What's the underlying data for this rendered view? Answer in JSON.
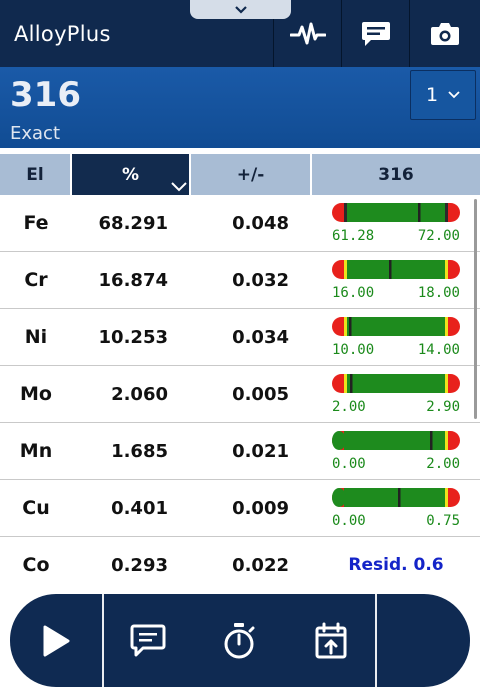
{
  "header": {
    "title": "AlloyPlus",
    "buttons": [
      {
        "icon": "waveform-icon"
      },
      {
        "icon": "comment-icon"
      },
      {
        "icon": "camera-icon"
      }
    ]
  },
  "banner": {
    "alloy_name": "316",
    "match_label": "Exact",
    "match_select_value": "1"
  },
  "columns": {
    "element": "El",
    "percent": "%",
    "error": "+/-",
    "grade": "316"
  },
  "rows": [
    {
      "el": "Fe",
      "pct": "68.291",
      "err": "0.048",
      "min": "61.28",
      "max": "72.00",
      "marker": 0.72,
      "low_zone": "red",
      "high_zone": "red"
    },
    {
      "el": "Cr",
      "pct": "16.874",
      "err": "0.032",
      "min": "16.00",
      "max": "18.00",
      "marker": 0.44,
      "low_zone": "yellow",
      "high_zone": "yellow"
    },
    {
      "el": "Ni",
      "pct": "10.253",
      "err": "0.034",
      "min": "10.00",
      "max": "14.00",
      "marker": 0.06,
      "low_zone": "yellow",
      "high_zone": "yellow"
    },
    {
      "el": "Mo",
      "pct": "2.060",
      "err": "0.005",
      "min": "2.00",
      "max": "2.90",
      "marker": 0.07,
      "low_zone": "yellow",
      "high_zone": "yellow"
    },
    {
      "el": "Mn",
      "pct": "1.685",
      "err": "0.021",
      "min": "0.00",
      "max": "2.00",
      "marker": 0.84,
      "low_zone": "none",
      "high_zone": "yellow"
    },
    {
      "el": "Cu",
      "pct": "0.401",
      "err": "0.009",
      "min": "0.00",
      "max": "0.75",
      "marker": 0.53,
      "low_zone": "none",
      "high_zone": "yellow"
    },
    {
      "el": "Co",
      "pct": "0.293",
      "err": "0.022",
      "resid": "Resid. 0.6"
    }
  ],
  "bottom_bar": {
    "buttons": [
      {
        "icon": "play-icon"
      },
      {
        "icon": "comment-icon"
      },
      {
        "icon": "stopwatch-icon"
      },
      {
        "icon": "calendar-upload-icon"
      }
    ]
  },
  "colors": {
    "header_bg": "#10294e",
    "banner_bg": "#1656a0",
    "bar_green": "#1e8b1e",
    "bar_red": "#e8211c",
    "bar_yellow": "#ede31c",
    "min_max_text": "#1b8a1b",
    "resid_text": "#1424c8"
  }
}
